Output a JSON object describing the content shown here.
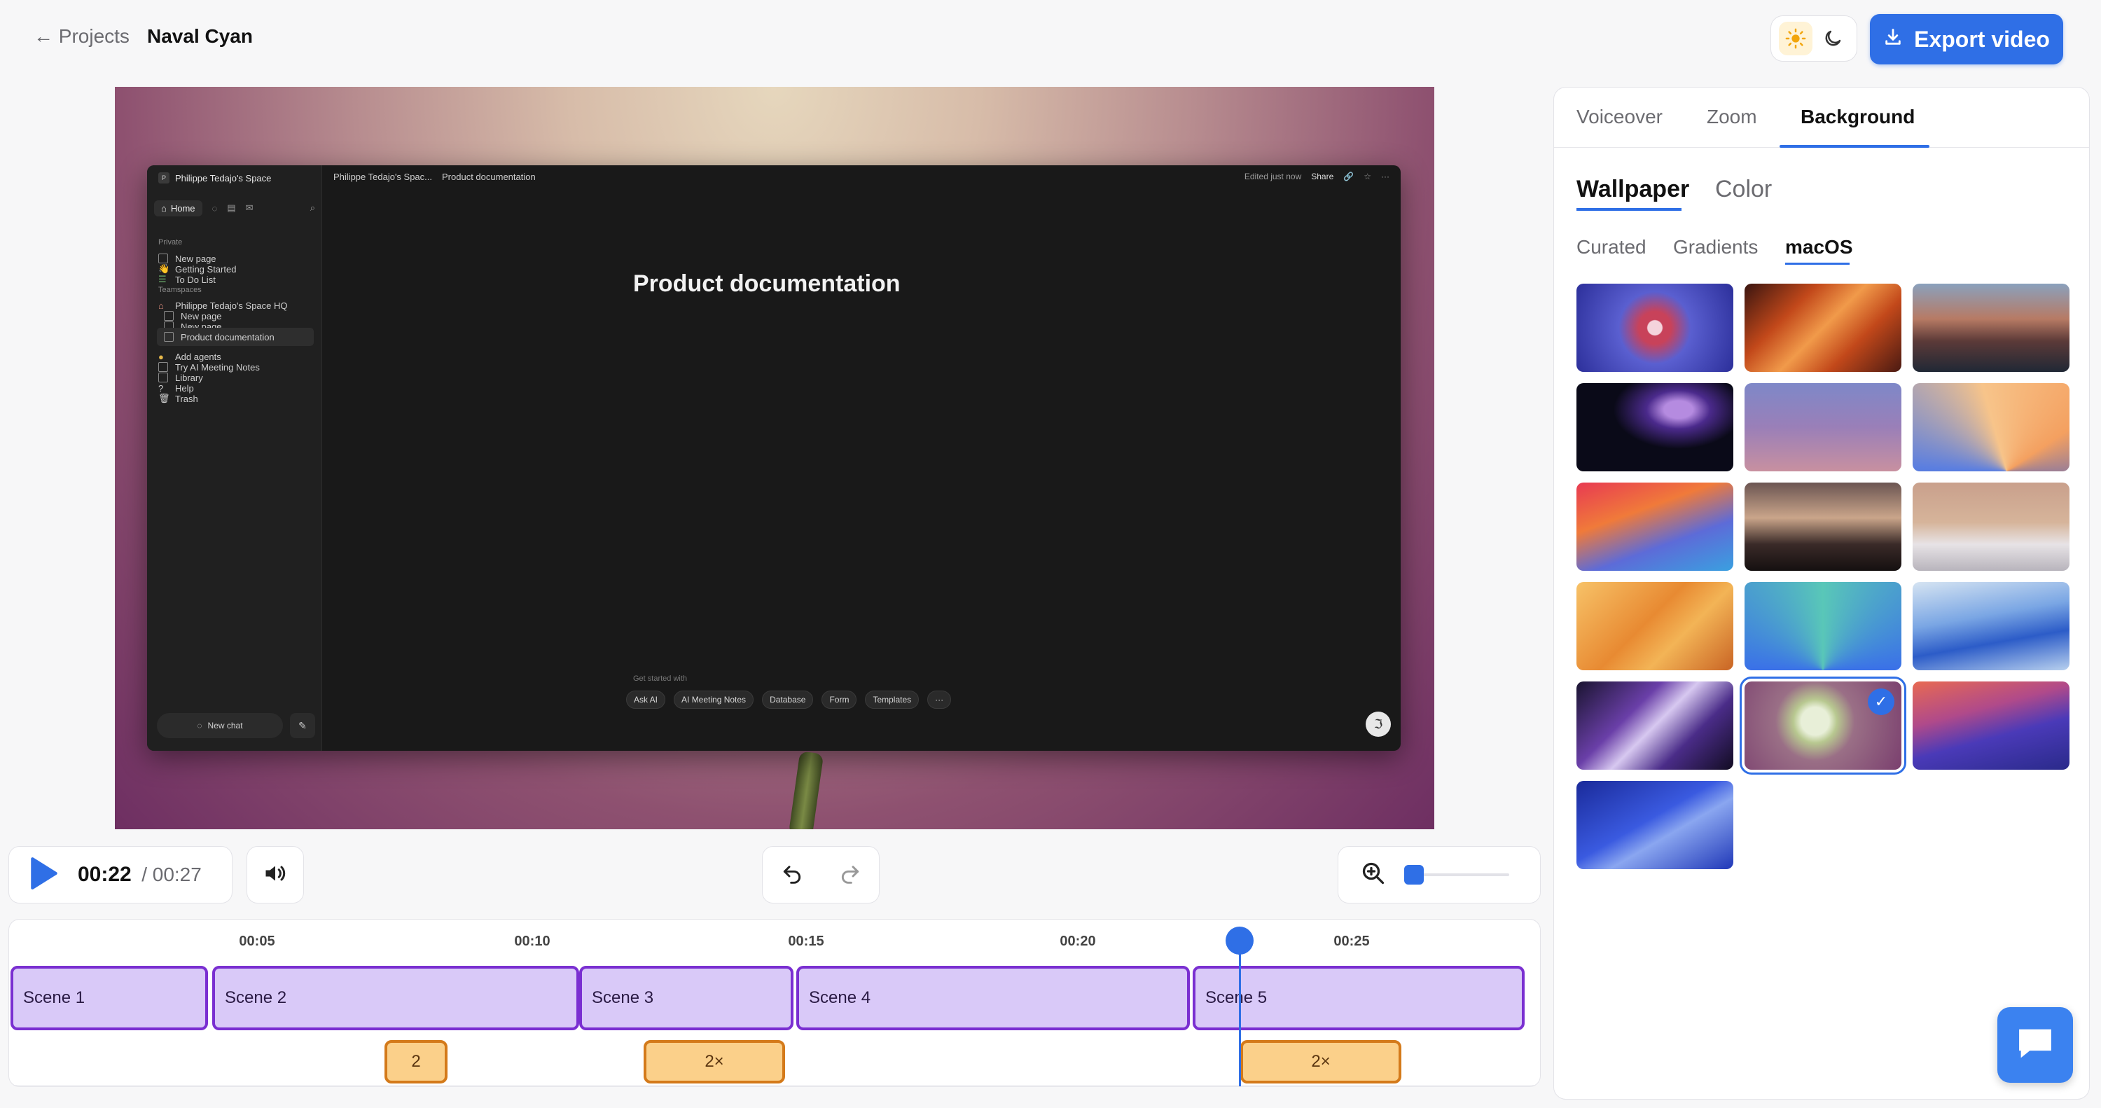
{
  "header": {
    "back_label": "← Projects",
    "project_name": "Naval Cyan",
    "export_label": "Export video"
  },
  "preview": {
    "workspace_badge": "P",
    "workspace_title": "Philippe Tedajo's Space",
    "home_label": "Home",
    "section_private": "Private",
    "private_items": [
      "New page",
      "Getting Started",
      "To Do List"
    ],
    "section_teamspaces": "Teamspaces",
    "team_items": [
      "Philippe Tedajo's Space HQ",
      "New page",
      "New page",
      "Product documentation"
    ],
    "extra_items": [
      "Add agents",
      "Try AI Meeting Notes",
      "Library",
      "Help",
      "Trash"
    ],
    "new_chat_label": "New chat",
    "crumb_ws": "Philippe Tedajo's Spac...",
    "crumb_page": "Product documentation",
    "edited_label": "Edited just now",
    "share_label": "Share",
    "doc_title": "Product documentation",
    "get_started": "Get started with",
    "chips": [
      "Ask AI",
      "AI Meeting Notes",
      "Database",
      "Form",
      "Templates",
      "···"
    ]
  },
  "controls": {
    "current_time": "00:22",
    "total_time": "/ 00:27",
    "zoom_level": 0
  },
  "timeline": {
    "ticks": [
      "00:05",
      "00:10",
      "00:15",
      "00:20",
      "00:25"
    ],
    "scenes": [
      "Scene 1",
      "Scene 2",
      "Scene 3",
      "Scene 4",
      "Scene 5"
    ],
    "zoom_clips": [
      "2",
      "2×",
      "2×"
    ]
  },
  "panel": {
    "tabs": [
      "Voiceover",
      "Zoom",
      "Background"
    ],
    "active_tab": "Background",
    "subtabs": [
      "Wallpaper",
      "Color"
    ],
    "categories": [
      "Curated",
      "Gradients",
      "macOS"
    ],
    "active_category": "macOS",
    "selected_wallpaper_index": 13
  },
  "colors": {
    "accent": "#2f6fe6",
    "scene_fill": "#d9c9f8",
    "scene_border": "#7a2fd1",
    "zoom_fill": "#fbd08a",
    "zoom_border": "#d47a1a"
  },
  "icons": {
    "theme_light": "sun-icon",
    "theme_dark": "moon-icon",
    "export": "download-icon",
    "play": "play-icon",
    "volume": "speaker-icon",
    "undo": "undo-icon",
    "redo": "redo-icon",
    "zoom": "zoom-in-icon",
    "chat": "chat-icon",
    "check": "check-icon"
  }
}
